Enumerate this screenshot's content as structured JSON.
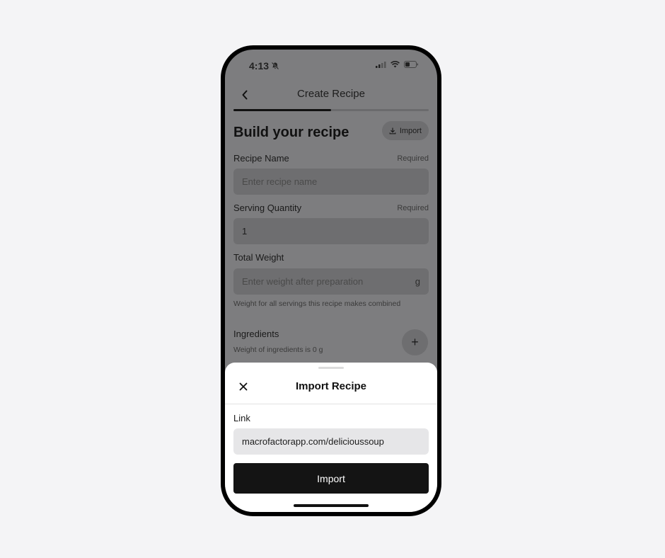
{
  "status_bar": {
    "time": "4:13",
    "icons": [
      "bell-slash-icon",
      "signal-icon",
      "wifi-icon",
      "battery-icon"
    ]
  },
  "nav": {
    "title": "Create Recipe",
    "back_icon": "chevron-left-icon",
    "progress": 0.5
  },
  "form": {
    "heading": "Build your recipe",
    "import_chip_label": "Import",
    "recipe_name": {
      "label": "Recipe Name",
      "required": "Required",
      "placeholder": "Enter recipe name"
    },
    "serving_quantity": {
      "label": "Serving Quantity",
      "required": "Required",
      "value": "1"
    },
    "total_weight": {
      "label": "Total Weight",
      "placeholder": "Enter weight after preparation",
      "unit": "g",
      "helper": "Weight for all servings this recipe makes combined"
    },
    "ingredients": {
      "label": "Ingredients",
      "helper": "Weight of ingredients is 0 g",
      "add_label": "+"
    }
  },
  "sheet": {
    "title": "Import Recipe",
    "link_label": "Link",
    "link_value": "macrofactorapp.com/delicioussoup",
    "import_button": "Import"
  }
}
